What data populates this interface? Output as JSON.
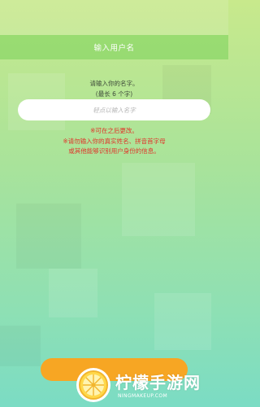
{
  "header": {
    "title": "输入用户名"
  },
  "prompt": {
    "line1": "请输入你的名字。",
    "line2": "(最长 6 个字)"
  },
  "name_input": {
    "value": "",
    "placeholder": "轻点以输入名字"
  },
  "notices": {
    "changeable": "※可在之后更改。",
    "privacy_line1": "※请勿输入你的真实姓名、拼音首字母",
    "privacy_line2": "或其他能够识别用户身份的信息。"
  },
  "watermark": {
    "brand": "柠檬手游网",
    "domain": "NINGMAKEUP.COM"
  },
  "colors": {
    "header_bg": "#7fd25a",
    "warning": "#e0342a",
    "button": "#f7a623"
  }
}
